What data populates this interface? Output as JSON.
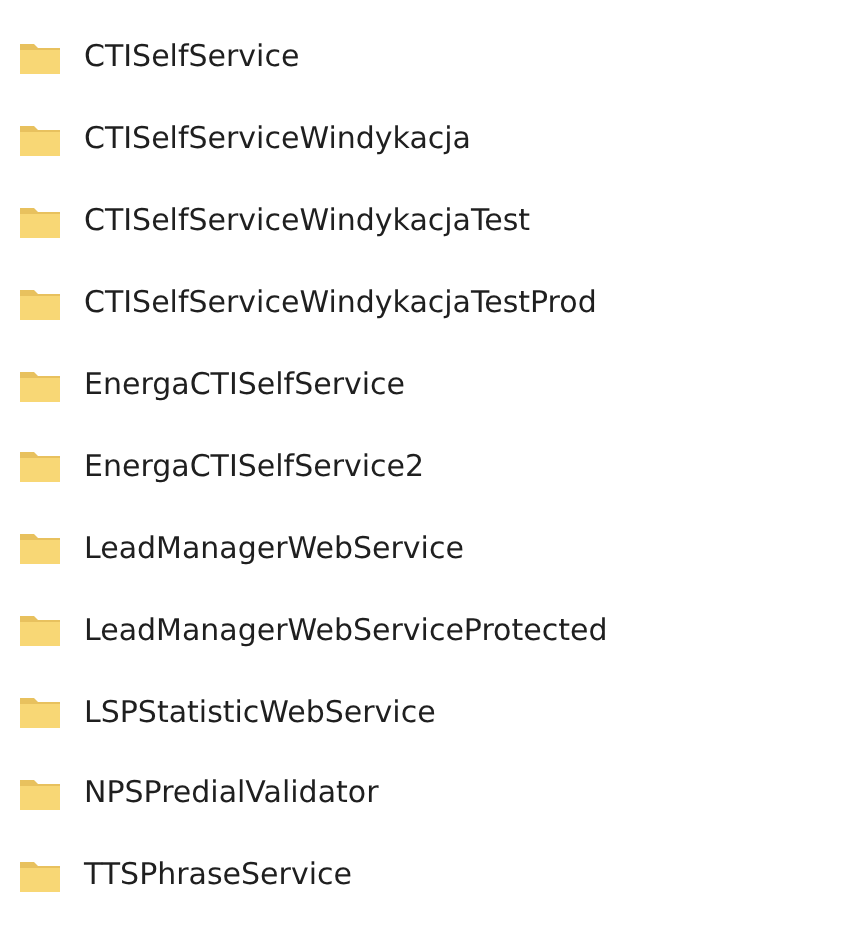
{
  "folders": [
    {
      "name": "CTISelfService"
    },
    {
      "name": "CTISelfServiceWindykacja"
    },
    {
      "name": "CTISelfServiceWindykacjaTest"
    },
    {
      "name": "CTISelfServiceWindykacjaTestProd"
    },
    {
      "name": "EnergaCTISelfService"
    },
    {
      "name": "EnergaCTISelfService2"
    },
    {
      "name": "LeadManagerWebService"
    },
    {
      "name": "LeadManagerWebServiceProtected"
    },
    {
      "name": "LSPStatisticWebService"
    },
    {
      "name": "NPSPredialValidator"
    },
    {
      "name": "TTSPhraseService"
    }
  ]
}
